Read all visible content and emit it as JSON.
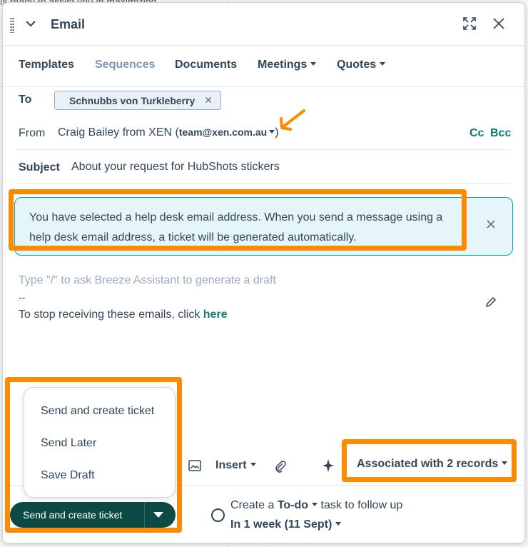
{
  "background": {
    "snippet": "is ready to assist you in maximizing"
  },
  "header": {
    "title": "Email"
  },
  "tabs": [
    {
      "label": "Templates"
    },
    {
      "label": "Sequences"
    },
    {
      "label": "Documents"
    },
    {
      "label": "Meetings"
    },
    {
      "label": "Quotes"
    }
  ],
  "to": {
    "label": "To",
    "recipient": "Schnubbs von Turkleberry"
  },
  "from": {
    "label": "From",
    "name": "Craig Bailey from XEN",
    "email": "team@xen.com.au",
    "cc": "Cc",
    "bcc": "Bcc"
  },
  "subject": {
    "label": "Subject",
    "value": "About your request for HubShots stickers"
  },
  "alert": {
    "message": "You have selected a help desk email address. When you send a message using a help desk email address, a ticket will be generated automatically."
  },
  "body": {
    "placeholder": "Type \"/\" to ask Breeze Assistant to generate a draft",
    "signature_dash": "--",
    "signature_text": "To stop receiving these emails, click",
    "signature_link": "here"
  },
  "toolbar": {
    "insert": "Insert",
    "associated": "Associated with 2 records"
  },
  "send_menu": {
    "items": [
      "Send and create ticket",
      "Send Later",
      "Save Draft"
    ]
  },
  "send_button": {
    "label": "Send and create ticket"
  },
  "followup": {
    "prefix": "Create a",
    "task_type": "To-do",
    "suffix": "task to follow up",
    "when": "In 1 week (11 Sept)"
  },
  "colors": {
    "accent": "#ff8a00",
    "primary": "#0b4a45",
    "link": "#0b7a75",
    "alert_bg": "#e5f5f8"
  }
}
